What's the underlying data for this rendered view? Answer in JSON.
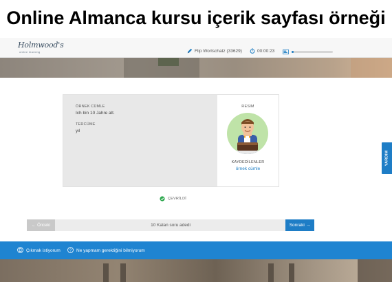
{
  "caption": "Online Almanca kursu içerik sayfası örneği",
  "header": {
    "logo_text": "Holmwood's",
    "logo_subtext": "online learning",
    "deck_name": "Flip Wortschatz (33629)",
    "timer": "00:00:23",
    "progress_fraction": 0.05
  },
  "card": {
    "sample_label": "ÖRNEK CÜMLE",
    "sample_text": "Ich bin 10 Jahre alt.",
    "translation_label": "TERCÜME",
    "translation_text": "yıl",
    "image_label": "RESIM",
    "saved_label": "KAYDEDİLENLER",
    "saved_item": "örnek cümle"
  },
  "status": {
    "text": "ÇEVRİLDİ",
    "color": "#2fa84f"
  },
  "nav": {
    "prev_label": "Önceki",
    "remaining_text": "10 Kalan soru adedi",
    "next_label": "Sonraki"
  },
  "help_tab": "YARDIM",
  "footer": {
    "quit_label": "Çıkmak istiyorum",
    "help_label": "Ne yapmam gerektiğini bilmiyorum"
  },
  "colors": {
    "accent": "#1e7dc6",
    "footer_bg": "#1f84d1",
    "link": "#1f7fc4"
  }
}
